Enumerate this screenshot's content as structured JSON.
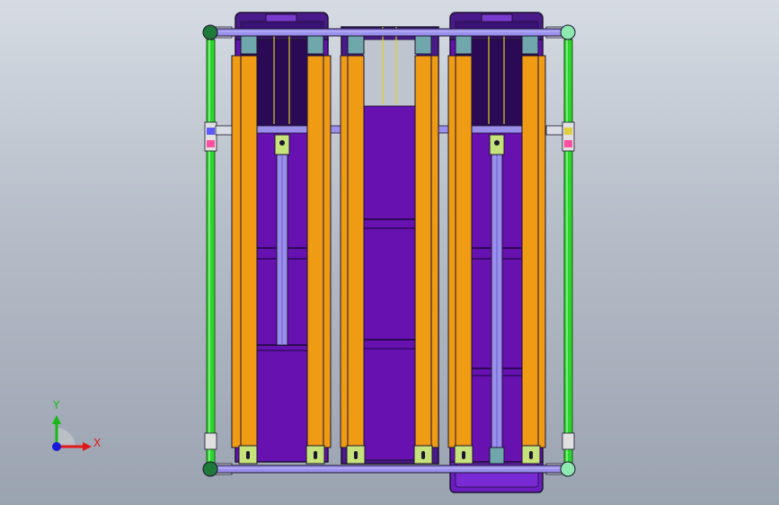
{
  "viewport": {
    "background_top": "#d6dbe3",
    "background_bottom": "#9aa3b0"
  },
  "colors": {
    "frame_purple": "#9b7fe0",
    "panel_purple": "#6611b0",
    "dark_purple": "#2a0a55",
    "orange": "#ef9b14",
    "green_tube": "#2bd52b",
    "teal_block": "#6fa7ac",
    "lime_block": "#c6e27a",
    "lavender_rail": "#9a90ec",
    "outline": "#1c1330"
  },
  "triad": {
    "x_label": "X",
    "y_label": "Y",
    "x_color": "#e01818",
    "y_color": "#18b818",
    "z_color": "#1a1ad8"
  }
}
